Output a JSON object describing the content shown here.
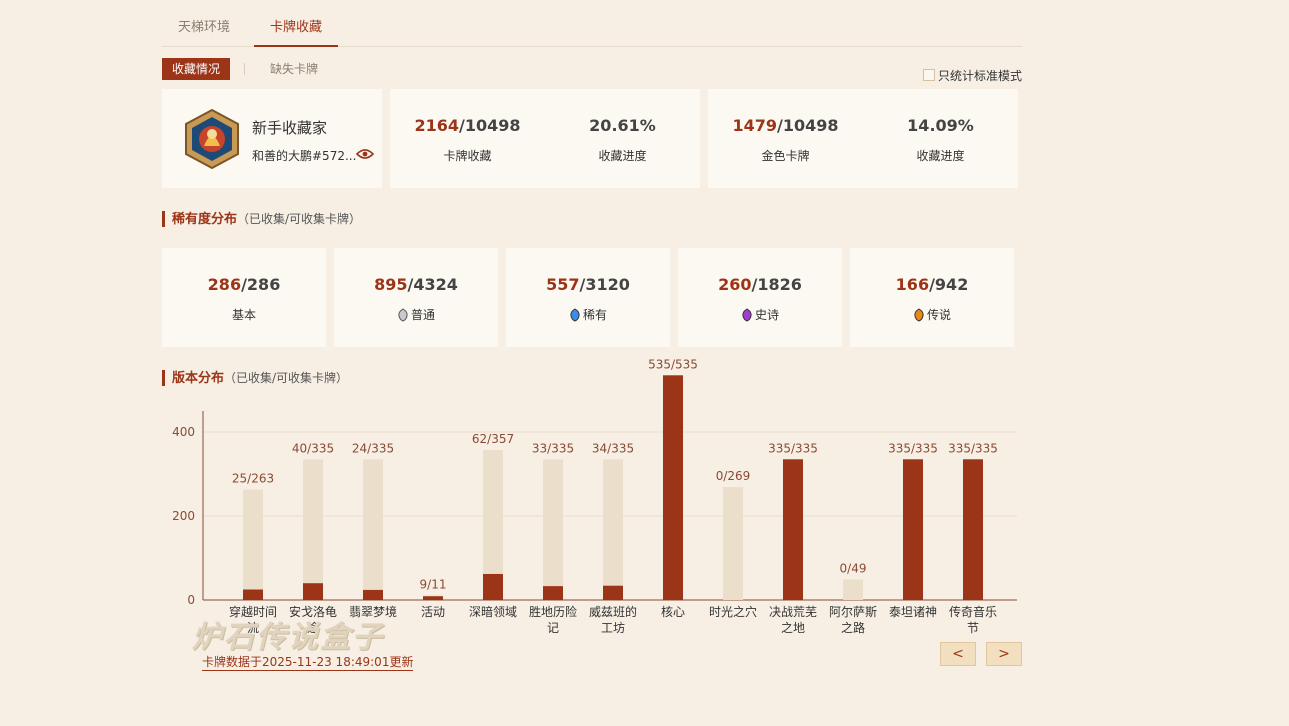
{
  "tabs": [
    "天梯环境",
    "卡牌收藏"
  ],
  "sub_tabs": {
    "active": "收藏情况",
    "inactive": "缺失卡牌"
  },
  "standard_only_label": "只统计标准模式",
  "profile": {
    "title": "新手收藏家",
    "user": "和善的大鹏#572..."
  },
  "collection": {
    "cards": {
      "owned": "2164",
      "total": "/10498",
      "label": "卡牌收藏",
      "pct": "20.61%",
      "pct_label": "收藏进度"
    },
    "golden": {
      "owned": "1479",
      "total": "/10498",
      "label": "金色卡牌",
      "pct": "14.09%",
      "pct_label": "收藏进度"
    }
  },
  "rarity_section": {
    "title": "稀有度分布",
    "note": "（已收集/可收集卡牌）"
  },
  "rarity": [
    {
      "owned": "286",
      "total": "/286",
      "label": "基本",
      "icon": "none",
      "color": ""
    },
    {
      "owned": "895",
      "total": "/4324",
      "label": "普通",
      "icon": "common-gem-icon",
      "color": "#b8b8b8"
    },
    {
      "owned": "557",
      "total": "/3120",
      "label": "稀有",
      "icon": "rare-gem-icon",
      "color": "#3a8ee6"
    },
    {
      "owned": "260",
      "total": "/1826",
      "label": "史诗",
      "icon": "epic-gem-icon",
      "color": "#a23fd0"
    },
    {
      "owned": "166",
      "total": "/942",
      "label": "传说",
      "icon": "legendary-gem-icon",
      "color": "#e8891c"
    }
  ],
  "version_section": {
    "title": "版本分布",
    "note": "（已收集/可收集卡牌）"
  },
  "chart_data": {
    "type": "bar",
    "categories": [
      "穿越时间流",
      "安戈洛龟途",
      "翡翠梦境",
      "活动",
      "深暗领域",
      "胜地历险记",
      "威兹班的工坊",
      "核心",
      "时光之穴",
      "决战荒芜之地",
      "阿尔萨斯之路",
      "泰坦诸神",
      "传奇音乐节"
    ],
    "category_lines": [
      [
        "穿越时间",
        "流"
      ],
      [
        "安戈洛龟",
        "途"
      ],
      [
        "翡翠梦境"
      ],
      [
        "活动"
      ],
      [
        "深暗领域"
      ],
      [
        "胜地历险",
        "记"
      ],
      [
        "威兹班的",
        "工坊"
      ],
      [
        "核心"
      ],
      [
        "时光之穴"
      ],
      [
        "决战荒芜",
        "之地"
      ],
      [
        "阿尔萨斯",
        "之路"
      ],
      [
        "泰坦诸神"
      ],
      [
        "传奇音乐",
        "节"
      ]
    ],
    "collected": [
      25,
      40,
      24,
      9,
      62,
      33,
      34,
      535,
      0,
      335,
      0,
      335,
      335
    ],
    "total": [
      263,
      335,
      335,
      11,
      357,
      335,
      335,
      535,
      269,
      335,
      49,
      335,
      335
    ],
    "labels": [
      "25/263",
      "40/335",
      "24/335",
      "9/11",
      "62/357",
      "33/335",
      "34/335",
      "535/535",
      "0/269",
      "335/335",
      "0/49",
      "335/335",
      "335/335"
    ],
    "yticks": [
      0,
      200,
      400
    ],
    "ylim": [
      0,
      450
    ],
    "colors": {
      "collected": "#9c3418",
      "total": "#ebdfcb"
    }
  },
  "watermark": "炉石传说盒子",
  "update_text": "卡牌数据于2025-11-23 18:49:01更新",
  "nav": {
    "prev": "<",
    "next": ">"
  }
}
